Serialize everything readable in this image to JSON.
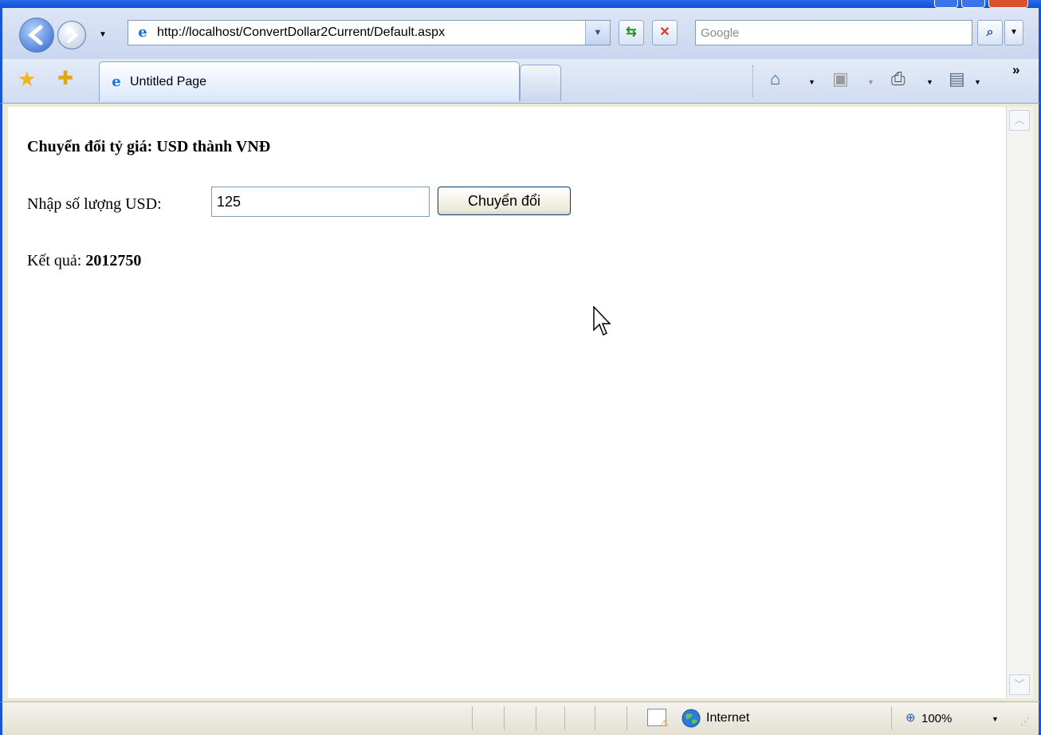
{
  "browser": {
    "address_url": "http://localhost/ConvertDollar2Current/Default.aspx",
    "search_placeholder": "Google",
    "tab_title": "Untitled Page",
    "more_chevron": "»"
  },
  "page": {
    "title": "Chuyển đổi tỷ giá: USD thành VNĐ",
    "input_label": "Nhập số lượng USD:",
    "input_value": "125",
    "button_label": "Chuyển đổi",
    "result_label": "Kết quả:",
    "result_value": "2012750"
  },
  "statusbar": {
    "zone": "Internet",
    "zoom": "100%"
  },
  "icons": [
    "back-arrow-icon",
    "forward-arrow-icon",
    "ie-page-icon",
    "refresh-icon",
    "stop-icon",
    "search-icon",
    "favorites-star-icon",
    "add-favorites-icon",
    "home-icon",
    "feeds-icon",
    "print-icon",
    "page-menu-icon",
    "globe-icon",
    "mouse-cursor-icon"
  ],
  "colors": {
    "xp_frame": "#1a54d8",
    "page_bg": "#ffffff",
    "chrome_bg": "#ece9d8"
  }
}
